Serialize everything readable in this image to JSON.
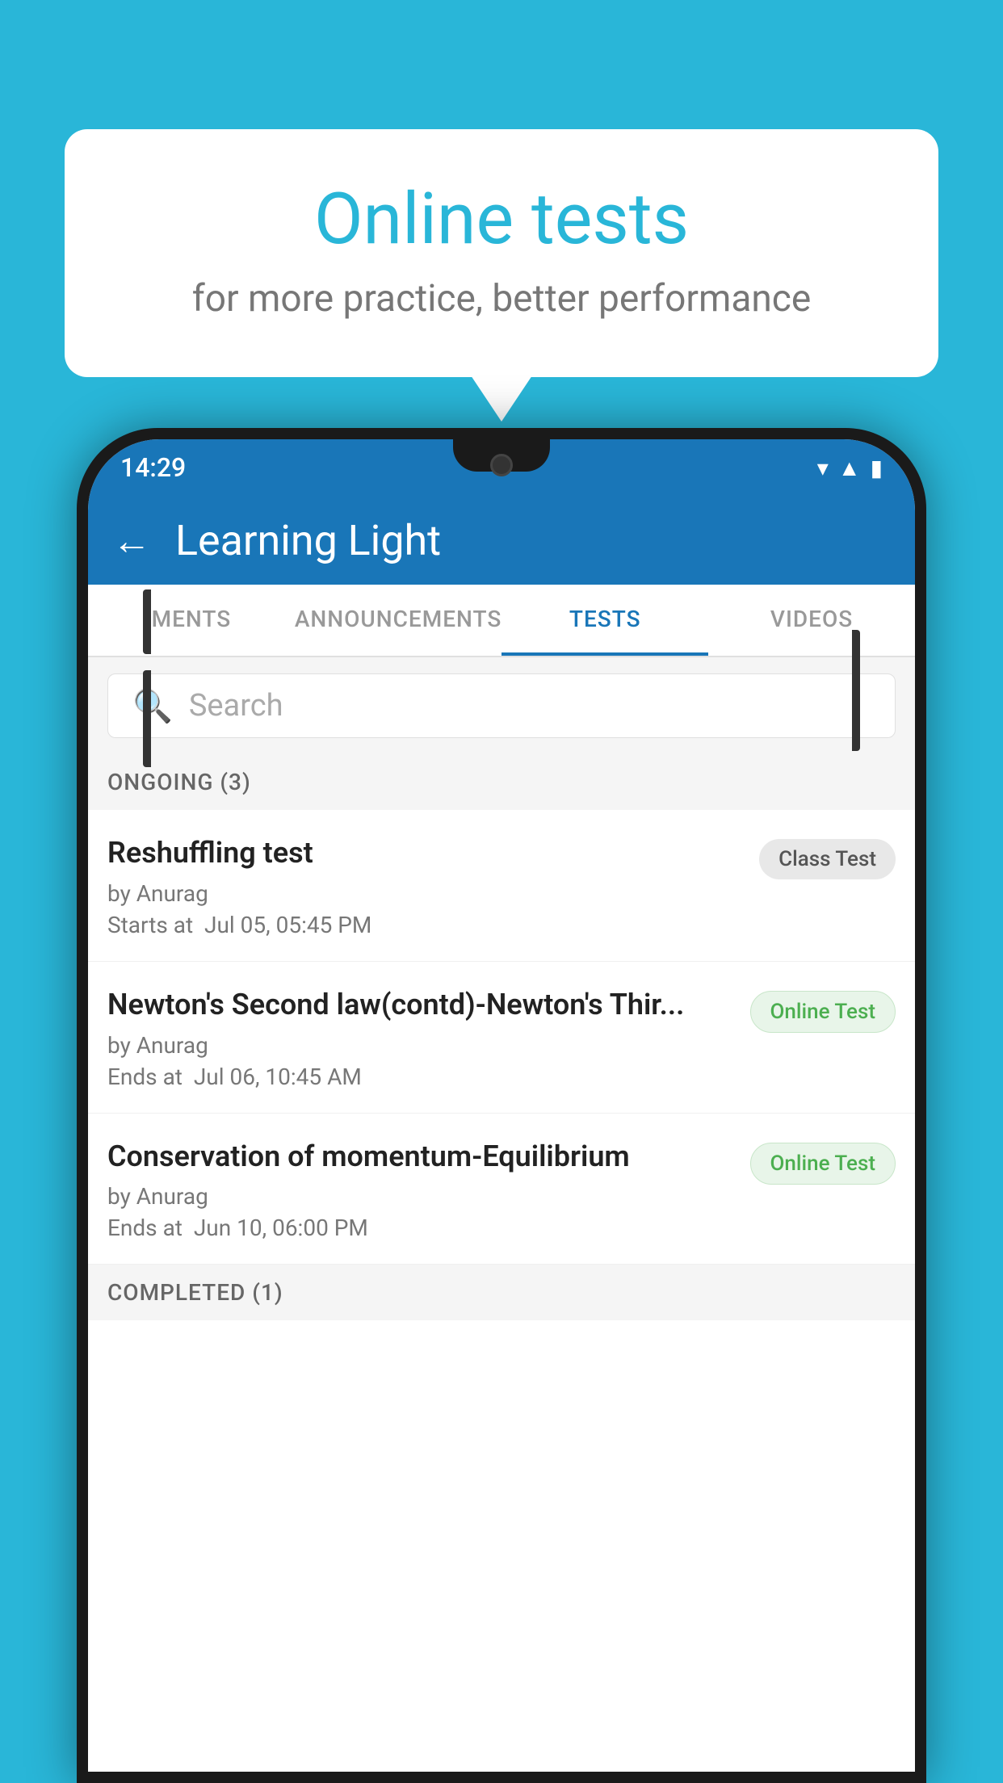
{
  "background_color": "#29B6D8",
  "speech_bubble": {
    "title": "Online tests",
    "subtitle": "for more practice, better performance"
  },
  "phone": {
    "status_bar": {
      "time": "14:29",
      "icons": [
        "wifi",
        "signal",
        "battery"
      ]
    },
    "app_bar": {
      "title": "Learning Light",
      "back_label": "←"
    },
    "tabs": [
      {
        "label": "MENTS",
        "active": false
      },
      {
        "label": "ANNOUNCEMENTS",
        "active": false
      },
      {
        "label": "TESTS",
        "active": true
      },
      {
        "label": "VIDEOS",
        "active": false
      }
    ],
    "search": {
      "placeholder": "Search"
    },
    "ongoing_section": {
      "label": "ONGOING (3)"
    },
    "test_items": [
      {
        "name": "Reshuffling test",
        "author": "by Anurag",
        "date_label": "Starts at",
        "date": "Jul 05, 05:45 PM",
        "badge": "Class Test",
        "badge_type": "class"
      },
      {
        "name": "Newton's Second law(contd)-Newton's Thir...",
        "author": "by Anurag",
        "date_label": "Ends at",
        "date": "Jul 06, 10:45 AM",
        "badge": "Online Test",
        "badge_type": "online"
      },
      {
        "name": "Conservation of momentum-Equilibrium",
        "author": "by Anurag",
        "date_label": "Ends at",
        "date": "Jun 10, 06:00 PM",
        "badge": "Online Test",
        "badge_type": "online"
      }
    ],
    "completed_section": {
      "label": "COMPLETED (1)"
    }
  }
}
